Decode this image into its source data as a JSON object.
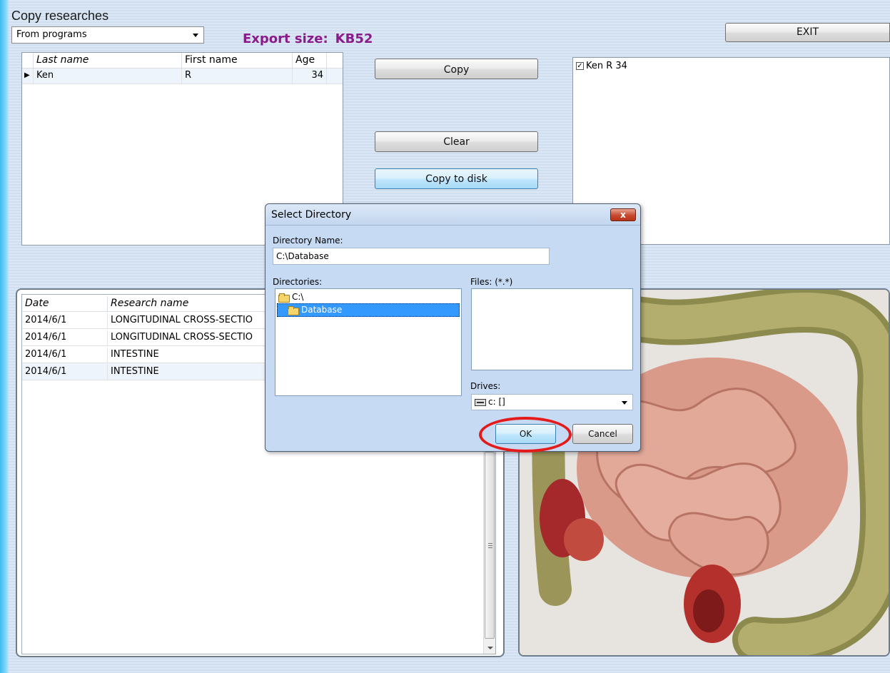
{
  "window": {
    "title": "Copy researches"
  },
  "source_combo": {
    "value": "From programs"
  },
  "export": {
    "label": "Export size:",
    "value": "KB52"
  },
  "buttons": {
    "exit": "EXIT",
    "copy": "Copy",
    "clear": "Clear",
    "copy_to_disk": "Copy to disk"
  },
  "patients": {
    "columns": [
      "Last name",
      "First name",
      "Age"
    ],
    "rows": [
      {
        "last": "Ken",
        "first": "R",
        "age": "34"
      }
    ]
  },
  "selected_list": {
    "items": [
      {
        "label": "Ken R  34",
        "checked": true
      }
    ]
  },
  "researches": {
    "columns": [
      "Date",
      "Research name"
    ],
    "rows": [
      {
        "date": "2014/6/1",
        "name": "LONGITUDINAL CROSS-SECTIO"
      },
      {
        "date": "2014/6/1",
        "name": "LONGITUDINAL CROSS-SECTIO"
      },
      {
        "date": "2014/6/1",
        "name": "INTESTINE"
      },
      {
        "date": "2014/6/1",
        "name": "INTESTINE"
      }
    ]
  },
  "dialog": {
    "title": "Select Directory",
    "close": "x",
    "directory_name_label": "Directory Name:",
    "directory_name_value": "C:\\Database",
    "directories_label": "Directories:",
    "directories": [
      "C:\\",
      "Database"
    ],
    "files_label": "Files: (*.*)",
    "drives_label": "Drives:",
    "drive_value": "c: []",
    "ok": "OK",
    "cancel": "Cancel"
  },
  "colors": {
    "export_text": "#8b1a8b",
    "highlight_ring": "#e31b1b",
    "selection": "#3399ff"
  }
}
